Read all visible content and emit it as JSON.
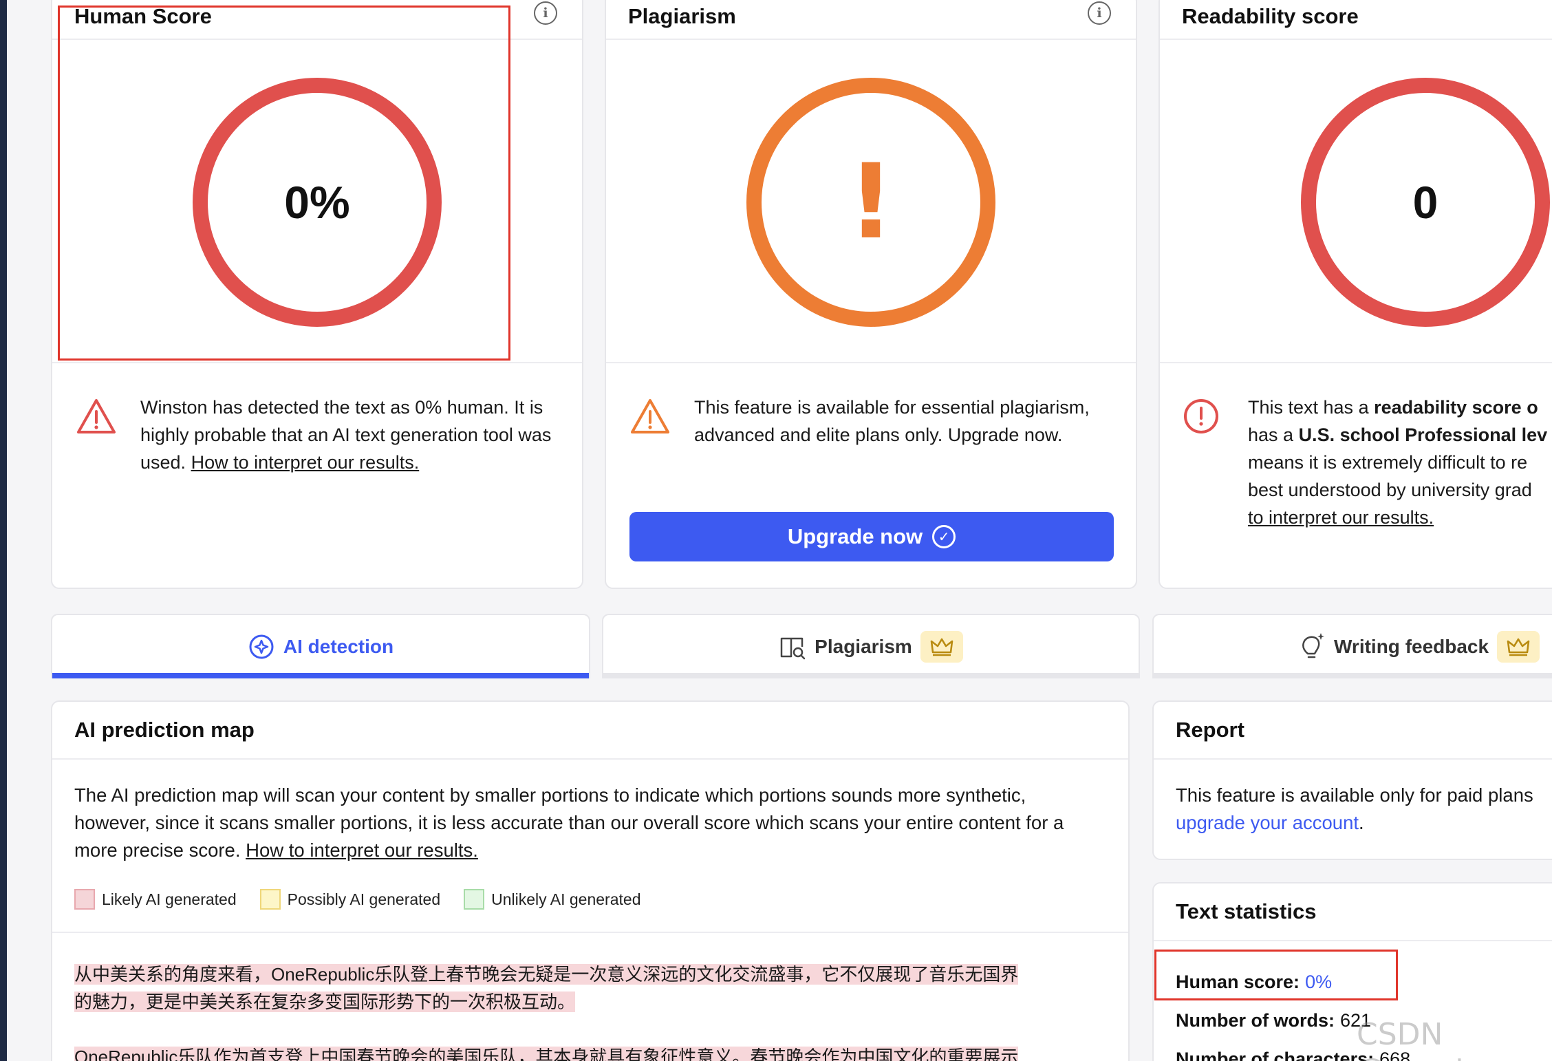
{
  "cards": {
    "human": {
      "title": "Human Score",
      "value": "0%",
      "message": "Winston has detected the text as 0% human. It is highly probable that an AI text generation tool was used.",
      "link": "How to interpret our results.",
      "gauge_color": "#e0504d"
    },
    "plagiarism": {
      "title": "Plagiarism",
      "value": "!",
      "message": "This feature is available for essential plagiarism, advanced and elite plans only. Upgrade now.",
      "button": "Upgrade now",
      "gauge_color": "#ed7d34"
    },
    "readability": {
      "title": "Readability score",
      "value": "0",
      "msg_part1": "This text has a ",
      "msg_bold1": "readability score o",
      "msg_part2": "has a ",
      "msg_bold2": "U.S. school Professional lev",
      "msg_line3": "means it is extremely difficult to re",
      "msg_line4": "best understood by university grad",
      "link": "to interpret our results.",
      "gauge_color": "#e0504d"
    }
  },
  "tabs": [
    {
      "label": "AI detection",
      "active": true,
      "icon": "ai-scan-icon"
    },
    {
      "label": "Plagiarism",
      "active": false,
      "icon": "book-search-icon",
      "premium": true
    },
    {
      "label": "Writing feedback",
      "active": false,
      "icon": "lightbulb-sparkle-icon",
      "premium": true
    }
  ],
  "prediction_map": {
    "title": "AI prediction map",
    "description": "The AI prediction map will scan your content by smaller portions to indicate which portions sounds more synthetic, however, since it scans smaller portions, it is less accurate than our overall score which scans your entire content for a more precise score.",
    "link": "How to interpret our results.",
    "legend": [
      {
        "label": "Likely AI generated",
        "color": "#f5d5d8",
        "border": "#e8a8ae"
      },
      {
        "label": "Possibly AI generated",
        "color": "#fdf6c8",
        "border": "#efd77a"
      },
      {
        "label": "Unlikely AI generated",
        "color": "#e3f7e3",
        "border": "#a8dca8"
      }
    ],
    "paragraphs": [
      "从中美关系的角度来看，OneRepublic乐队登上春节晚会无疑是一次意义深远的文化交流盛事，它不仅展现了音乐无国界",
      "的魅力，更是中美关系在复杂多变国际形势下的一次积极互动。",
      "OneRepublic乐队作为首支登上中国春节晚会的美国乐队，其本身就具有象征性意义。春节晚会作为中国文化的重要展示"
    ]
  },
  "report": {
    "title": "Report",
    "text": "This feature is available only for paid plans",
    "link": "upgrade your account",
    "suffix": "."
  },
  "text_statistics": {
    "title": "Text statistics",
    "human_score_label": "Human score:",
    "human_score_value": "0%",
    "words_label": "Number of words:",
    "words_value": "621",
    "chars_label": "Number of characters:",
    "chars_value": "668"
  },
  "watermark": "CSDN @xyzcto"
}
